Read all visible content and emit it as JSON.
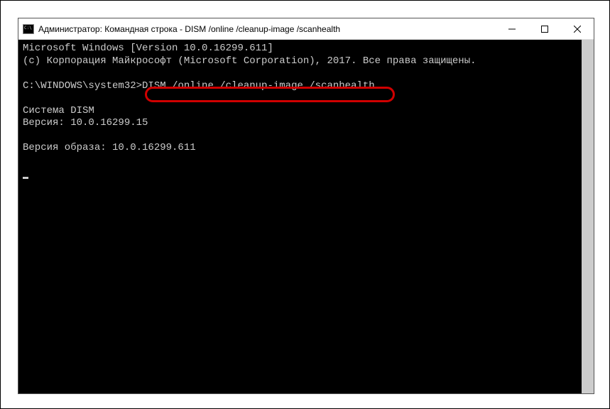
{
  "window": {
    "title": "Администратор: Командная строка - DISM /online /cleanup-image /scanhealth"
  },
  "terminal": {
    "line1": "Microsoft Windows [Version 10.0.16299.611]",
    "line2": "(c) Корпорация Майкрософт (Microsoft Corporation), 2017. Все права защищены.",
    "blank1": " ",
    "prompt": "C:\\WINDOWS\\system32>",
    "command": "DISM /online /cleanup-image /scanhealth",
    "blank2": " ",
    "dism_header": "Cистема DISM",
    "dism_version": "Версия: 10.0.16299.15",
    "blank3": " ",
    "image_version": "Версия образа: 10.0.16299.611",
    "blank4": " "
  }
}
